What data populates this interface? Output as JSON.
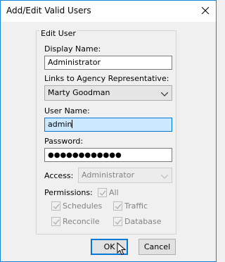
{
  "window": {
    "title": "Add/Edit Valid Users",
    "close_label": "✕"
  },
  "group": {
    "legend": "Edit User"
  },
  "display_name": {
    "label": "Display Name:",
    "value": "Administrator"
  },
  "agency_rep": {
    "label": "Links to Agency Representative:",
    "value": "Marty Goodman"
  },
  "user_name": {
    "label": "User Name:",
    "value": "admin"
  },
  "password": {
    "label": "Password:",
    "value": "●●●●●●●●●●●●"
  },
  "access": {
    "label": "Access:",
    "value": "Administrator"
  },
  "permissions": {
    "label": "Permissions:",
    "all": "All",
    "schedules": "Schedules",
    "traffic": "Traffic",
    "reconcile": "Reconcile",
    "database": "Database"
  },
  "buttons": {
    "ok": "OK",
    "cancel": "Cancel"
  }
}
